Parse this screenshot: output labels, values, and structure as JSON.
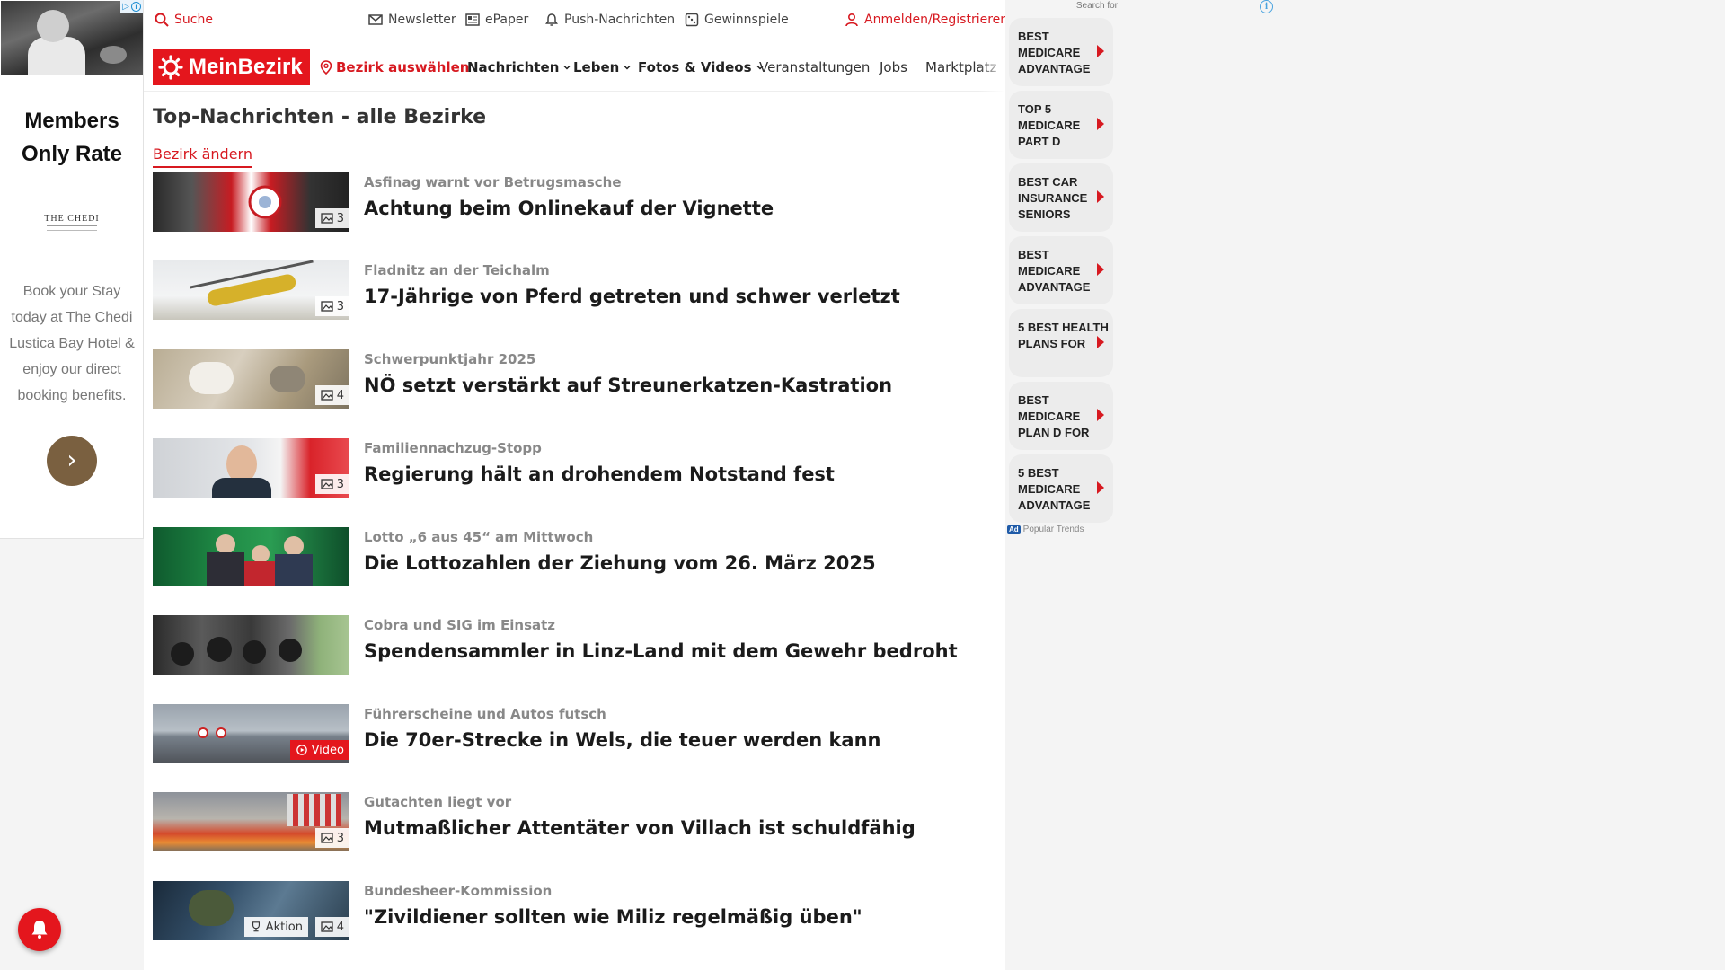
{
  "left_ad": {
    "adchoices": "▷",
    "headline": "Members Only Rate",
    "brand": "THE CHEDI",
    "body": "Book your Stay today at The Chedi Lustica Bay Hotel & enjoy our direct booking benefits.",
    "cta_icon": "chevron-right-icon"
  },
  "topbar": {
    "search": "Suche",
    "newsletter": "Newsletter",
    "epaper": "ePaper",
    "push": "Push-Nachrichten",
    "gewinnspiele": "Gewinnspiele",
    "login": "Anmelden/Registrieren"
  },
  "nav": {
    "logo": "MeinBezirk",
    "district": "Bezirk auswählen",
    "items": [
      "Nachrichten",
      "Leben",
      "Fotos & Videos",
      "Veranstaltungen",
      "Jobs",
      "Marktplatz"
    ]
  },
  "page": {
    "title": "Top-Nachrichten - alle Bezirke",
    "change_district": "Bezirk ändern"
  },
  "articles": [
    {
      "kicker": "Asfinag warnt vor Betrugsmasche",
      "headline": "Achtung beim Onlinekauf der Vignette",
      "badge": "3",
      "badge_type": "gallery"
    },
    {
      "kicker": "Fladnitz an der Teichalm",
      "headline": "17-Jährige von Pferd getreten und schwer verletzt",
      "badge": "3",
      "badge_type": "gallery"
    },
    {
      "kicker": "Schwerpunktjahr 2025",
      "headline": "NÖ setzt verstärkt auf Streunerkatzen-Kastration",
      "badge": "4",
      "badge_type": "gallery"
    },
    {
      "kicker": "Familiennachzug-Stopp",
      "headline": "Regierung hält an drohendem Notstand fest",
      "badge": "3",
      "badge_type": "gallery"
    },
    {
      "kicker": "Lotto „6 aus 45“ am Mittwoch",
      "headline": "Die Lottozahlen der Ziehung vom 26. März 2025",
      "badge": "",
      "badge_type": "none"
    },
    {
      "kicker": "Cobra und SIG im Einsatz",
      "headline": "Spendensammler in Linz-Land mit dem Gewehr bedroht",
      "badge": "",
      "badge_type": "none"
    },
    {
      "kicker": "Führerscheine und Autos futsch",
      "headline": "Die 70er-Strecke in Wels, die teuer werden kann",
      "badge": "Video",
      "badge_type": "video"
    },
    {
      "kicker": "Gutachten liegt vor",
      "headline": "Mutmaßlicher Attentäter von Villach ist schuldfähig",
      "badge": "3",
      "badge_type": "gallery"
    },
    {
      "kicker": "Bundesheer-Kommission",
      "headline": "\"Zivildiener sollten wie Miliz regelmäßig üben\"",
      "badge": "4",
      "badge_type": "gallery",
      "extra_badge": "Aktion"
    }
  ],
  "right_ad": {
    "search_for": "Search for",
    "keywords": [
      "BEST MEDICARE ADVANTAGE",
      "TOP 5 MEDICARE PART D",
      "BEST CAR INSURANCE SENIORS",
      "BEST MEDICARE ADVANTAGE",
      "5 BEST HEALTH PLANS FOR",
      "BEST MEDICARE PLAN D FOR",
      "5 BEST MEDICARE ADVANTAGE"
    ],
    "ad_label": "Ad",
    "footer": "Popular Trends"
  },
  "colors": {
    "brand_red": "#e4161d",
    "link_red": "#d71920"
  }
}
